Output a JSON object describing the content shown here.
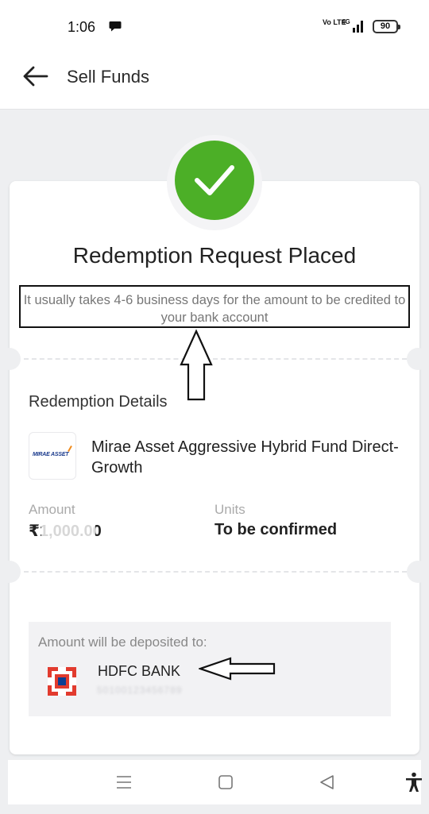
{
  "status_bar": {
    "time": "1:06",
    "network_label": "Vo LTE",
    "battery": "90"
  },
  "header": {
    "title": "Sell Funds"
  },
  "confirmation": {
    "heading": "Redemption Request Placed",
    "message": "It usually takes 4-6 business days for the amount to be credited to your bank account"
  },
  "details": {
    "section_title": "Redemption Details",
    "fund_name": "Mirae Asset Aggressive Hybrid Fund Direct-Growth",
    "fund_logo_text": "MIRAE ASSET",
    "amount_label": "Amount",
    "amount_value": "₹1,000.00",
    "units_label": "Units",
    "units_value": "To be confirmed"
  },
  "deposit": {
    "caption": "Amount will be deposited to:",
    "bank_name": "HDFC BANK",
    "account_number": "50100123456789"
  },
  "icons": {
    "back": "arrow-left-icon",
    "success": "checkmark-icon",
    "bank": "hdfc-logo-icon",
    "nav": [
      "menu-icon",
      "home-square-icon",
      "back-triangle-icon",
      "accessibility-icon"
    ]
  },
  "colors": {
    "success_green": "#4caf27",
    "hdfc_red": "#e23b2e",
    "hdfc_blue": "#0d3f93"
  }
}
